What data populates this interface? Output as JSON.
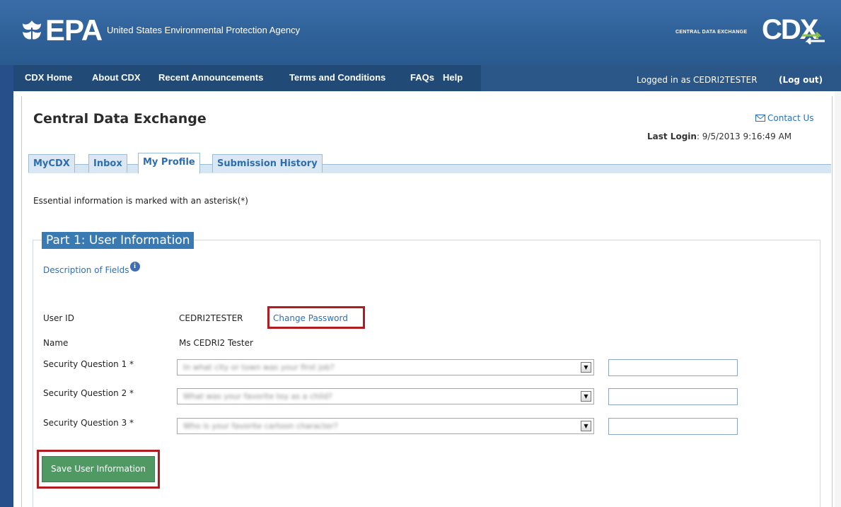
{
  "header": {
    "brand": "EPA",
    "agency": "United States Environmental Protection Agency",
    "cdx_tagline": "CENTRAL DATA EXCHANGE",
    "cdx_logo": "CDX"
  },
  "nav": {
    "items": [
      "CDX Home",
      "About CDX",
      "Recent Announcements",
      "Terms and Conditions",
      "FAQs",
      "Help"
    ],
    "logged_in_text": "Logged in as CEDRI2TESTER",
    "logout_label": "(Log out)"
  },
  "page": {
    "title": "Central Data Exchange",
    "contact_label": "Contact Us",
    "last_login_label": "Last Login",
    "last_login_value": ": 9/5/2013 9:16:49 AM"
  },
  "tabs": [
    {
      "label": "MyCDX",
      "active": false
    },
    {
      "label": "Inbox",
      "active": false
    },
    {
      "label": "My Profile",
      "active": true
    },
    {
      "label": "Submission History",
      "active": false
    }
  ],
  "form": {
    "essential_note": "Essential information is marked with an asterisk(*)",
    "legend": "Part 1: User Information",
    "description_link": "Description of Fields",
    "user_id_label": "User ID",
    "user_id_value": "CEDRI2TESTER",
    "change_password_label": "Change Password",
    "name_label": "Name",
    "name_value": "Ms CEDRI2 Tester",
    "security_questions": [
      {
        "label": "Security Question 1 *",
        "selected": "In what city or town was your first job?",
        "answer": ""
      },
      {
        "label": "Security Question 2 *",
        "selected": "What was your favorite toy as a child?",
        "answer": ""
      },
      {
        "label": "Security Question 3 *",
        "selected": "Who is your favorite cartoon character?",
        "answer": ""
      }
    ],
    "save_label": "Save User Information"
  },
  "colors": {
    "header_blue": "#2e6097",
    "nav_blue": "#214a77",
    "link_blue": "#2a6fb8",
    "legend_blue": "#3a7ab2",
    "save_green": "#4f9a63",
    "highlight_red": "#b01c20"
  }
}
